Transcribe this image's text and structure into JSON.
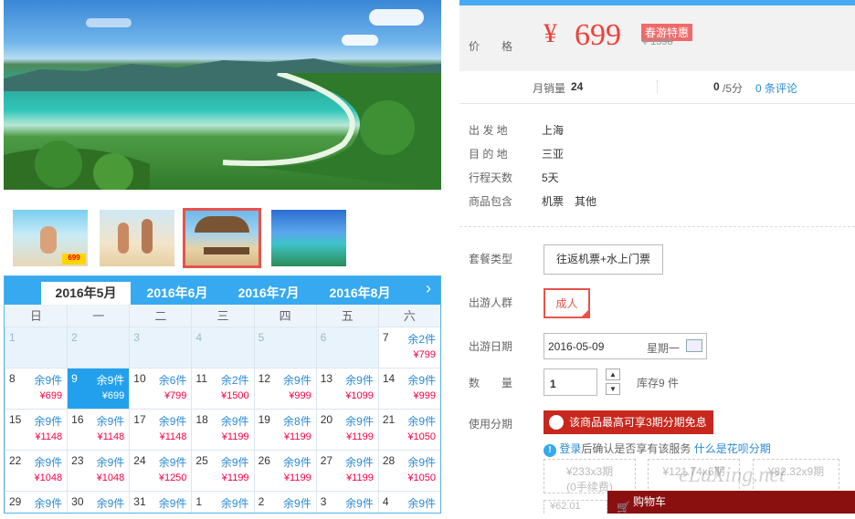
{
  "thumbs": [
    {
      "name": "thumb-beach-promo"
    },
    {
      "name": "thumb-volleyball"
    },
    {
      "name": "thumb-beach-umbrella"
    },
    {
      "name": "thumb-coast"
    }
  ],
  "calendar": {
    "months": [
      "2016年5月",
      "2016年6月",
      "2016年7月",
      "2016年8月"
    ],
    "next_icon": "›",
    "weekdays": [
      "日",
      "一",
      "二",
      "三",
      "四",
      "五",
      "六"
    ],
    "weeks": [
      [
        {
          "day": "1",
          "past": true
        },
        {
          "day": "2",
          "past": true
        },
        {
          "day": "3",
          "past": true
        },
        {
          "day": "4",
          "past": true
        },
        {
          "day": "5",
          "past": true
        },
        {
          "day": "6",
          "past": true
        },
        {
          "day": "7",
          "stock": "余2件",
          "price": "¥799"
        }
      ],
      [
        {
          "day": "8",
          "stock": "余9件",
          "price": "¥699"
        },
        {
          "day": "9",
          "stock": "余9件",
          "price": "¥699",
          "selected": true
        },
        {
          "day": "10",
          "stock": "余6件",
          "price": "¥799"
        },
        {
          "day": "11",
          "stock": "余2件",
          "price": "¥1500"
        },
        {
          "day": "12",
          "stock": "余9件",
          "price": "¥999"
        },
        {
          "day": "13",
          "stock": "余9件",
          "price": "¥1099"
        },
        {
          "day": "14",
          "stock": "余9件",
          "price": "¥999"
        }
      ],
      [
        {
          "day": "15",
          "stock": "余9件",
          "price": "¥1148"
        },
        {
          "day": "16",
          "stock": "余9件",
          "price": "¥1148"
        },
        {
          "day": "17",
          "stock": "余9件",
          "price": "¥1148"
        },
        {
          "day": "18",
          "stock": "余9件",
          "price": "¥1199"
        },
        {
          "day": "19",
          "stock": "余8件",
          "price": "¥1199"
        },
        {
          "day": "20",
          "stock": "余9件",
          "price": "¥1199"
        },
        {
          "day": "21",
          "stock": "余9件",
          "price": "¥1050"
        }
      ],
      [
        {
          "day": "22",
          "stock": "余9件",
          "price": "¥1048"
        },
        {
          "day": "23",
          "stock": "余9件",
          "price": "¥1048"
        },
        {
          "day": "24",
          "stock": "余9件",
          "price": "¥1250"
        },
        {
          "day": "25",
          "stock": "余9件",
          "price": "¥1199"
        },
        {
          "day": "26",
          "stock": "余9件",
          "price": "¥1199"
        },
        {
          "day": "27",
          "stock": "余9件",
          "price": "¥1199"
        },
        {
          "day": "28",
          "stock": "余9件",
          "price": "¥1050"
        }
      ],
      [
        {
          "day": "29",
          "stock": "余9件",
          "price": ""
        },
        {
          "day": "30",
          "stock": "余9件",
          "price": ""
        },
        {
          "day": "31",
          "stock": "余9件",
          "price": ""
        },
        {
          "day": "1",
          "stock": "余9件",
          "price": ""
        },
        {
          "day": "2",
          "stock": "余9件",
          "price": ""
        },
        {
          "day": "3",
          "stock": "余9件",
          "price": ""
        },
        {
          "day": "4",
          "stock": "余9件",
          "price": ""
        }
      ]
    ]
  },
  "price": {
    "label": "价　　格",
    "currency": "¥",
    "value": "699",
    "promo": "春游特惠",
    "original": "¥ 1398"
  },
  "stats": {
    "sales_label": "月销量",
    "sales_value": "24",
    "score_value": "0",
    "score_suffix": "/5分",
    "reviews": "0 条评论"
  },
  "info": [
    {
      "key": "出 发 地",
      "value": "上海"
    },
    {
      "key": "目 的 地",
      "value": "三亚"
    },
    {
      "key": "行程天数",
      "value": "5天"
    },
    {
      "key": "商品包含",
      "value": "机票　其他"
    }
  ],
  "options": {
    "package_label": "套餐类型",
    "package_value": "往返机票+水上门票",
    "people_label": "出游人群",
    "people_value": "成人",
    "date_label": "出游日期",
    "date_value": "2016-05-09",
    "weekday_value": "星期一",
    "qty_label": "数　　量",
    "qty_value": "1",
    "stock_text": "库存9 件",
    "install_label": "使用分期",
    "install_banner": "该商品最高可享3期分期免息",
    "login_link": "登录",
    "login_note": "后确认是否享有该服务",
    "huabei_link": "什么是花呗分期",
    "plans": [
      {
        "amount": "¥233x3期",
        "fee": "(0手续费)"
      },
      {
        "amount": "¥121.74x6期",
        "fee": ""
      },
      {
        "amount": "¥82.32x9期",
        "fee": ""
      }
    ],
    "plan4": "¥62.01",
    "cart_label": "购物车",
    "watermark": "eLuXing.net"
  },
  "colors": {
    "accent_blue": "#36a9f0",
    "price_red": "#f0413a",
    "promo_bg": "#f06a6a",
    "install_red": "#c8271d"
  }
}
